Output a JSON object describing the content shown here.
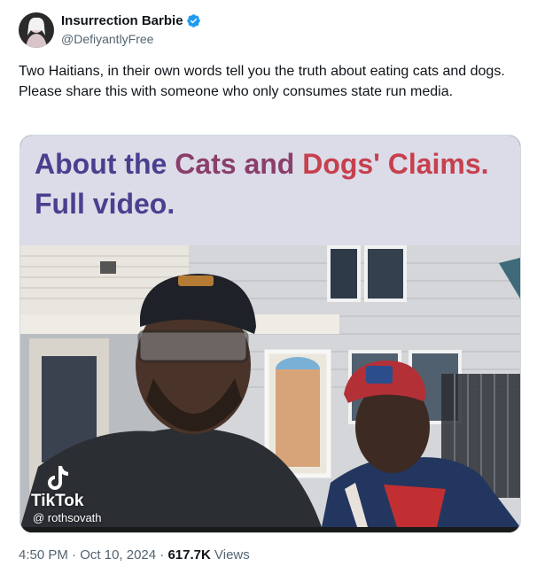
{
  "author": {
    "display_name": "Insurrection Barbie",
    "handle": "@DefiyantlyFree",
    "verified": true,
    "avatar_icon": "avatar"
  },
  "tweet": {
    "text": "Two Haitians, in their own words tell you the truth about eating cats and dogs. Please share this with someone who only consumes state run media."
  },
  "media": {
    "caption_parts": [
      "About the ",
      "Cats and ",
      "Dogs' Claims.",
      "Full video."
    ],
    "watermark_brand": "TikTok",
    "watermark_user": "@ rothsovath"
  },
  "meta": {
    "time": "4:50 PM",
    "separator": "·",
    "date": "Oct 10, 2024",
    "views_count": "617.7K",
    "views_label": " Views"
  },
  "colors": {
    "verified_blue": "#1d9bf0",
    "text_primary": "#0f1419",
    "text_secondary": "#536471"
  }
}
